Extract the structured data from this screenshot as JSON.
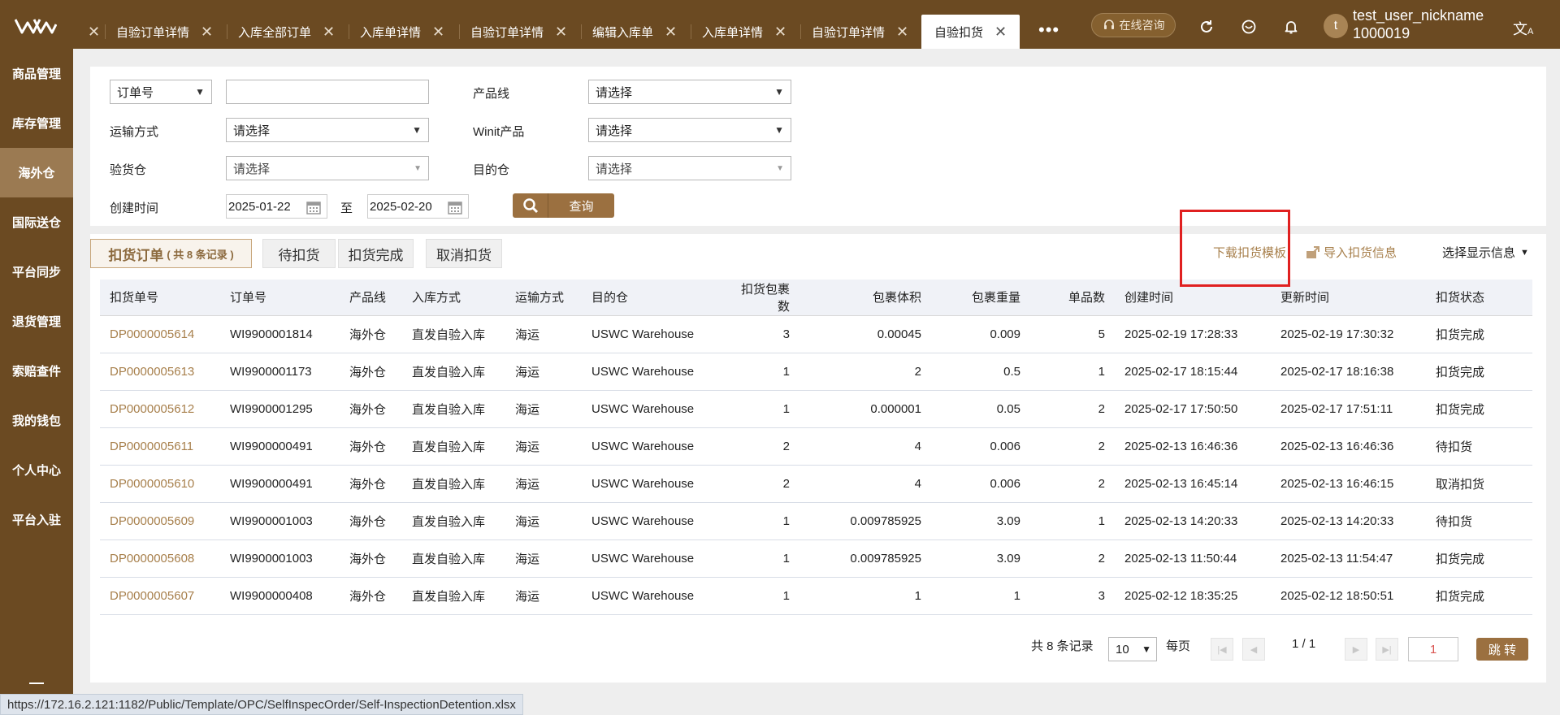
{
  "topbar": {
    "tabs": [
      {
        "label": "自验订单详情"
      },
      {
        "label": "入库全部订单"
      },
      {
        "label": "入库单详情"
      },
      {
        "label": "自验订单详情"
      },
      {
        "label": "编辑入库单"
      },
      {
        "label": "入库单详情"
      },
      {
        "label": "自验订单详情"
      },
      {
        "label": "自验扣货"
      }
    ],
    "active_tab": "自验扣货",
    "more": "•••",
    "consult_label": "在线咨询",
    "user": {
      "avatar_letter": "t",
      "nickname": "test_user_nickname",
      "id": "1000019"
    }
  },
  "sidebar": {
    "items": [
      {
        "label": "商品管理"
      },
      {
        "label": "库存管理"
      },
      {
        "label": "海外仓"
      },
      {
        "label": "国际送仓"
      },
      {
        "label": "平台同步"
      },
      {
        "label": "退货管理"
      },
      {
        "label": "索赔查件"
      },
      {
        "label": "我的钱包"
      },
      {
        "label": "个人中心"
      },
      {
        "label": "平台入驻"
      }
    ],
    "active": "海外仓"
  },
  "filters": {
    "order_type": {
      "value": "订单号"
    },
    "order_no": {
      "value": ""
    },
    "product_line": {
      "label": "产品线",
      "value": "请选择"
    },
    "shipping": {
      "label": "运输方式",
      "value": "请选择"
    },
    "winit_product": {
      "label": "Winit产品",
      "value": "请选择"
    },
    "inspect_wh": {
      "label": "验货仓",
      "value": "请选择"
    },
    "dest_wh": {
      "label": "目的仓",
      "value": "请选择"
    },
    "created": {
      "label": "创建时间",
      "from": "2025-01-22",
      "to_label": "至",
      "to": "2025-02-20"
    },
    "search_label": "查询"
  },
  "status_tabs": [
    {
      "label": "扣货订单",
      "count_text": "( 共 8 条记录 )"
    },
    {
      "label": "待扣货"
    },
    {
      "label": "扣货完成"
    },
    {
      "label": "取消扣货"
    }
  ],
  "actions": {
    "download_template": "下载扣货模板",
    "import_info": "导入扣货信息",
    "select_display": "选择显示信息"
  },
  "table": {
    "columns": [
      "扣货单号",
      "订单号",
      "产品线",
      "入库方式",
      "运输方式",
      "目的仓",
      "扣货包裹数",
      "包裹体积",
      "包裹重量",
      "单品数",
      "创建时间",
      "更新时间",
      "扣货状态"
    ],
    "rows": [
      [
        "DP0000005614",
        "WI9900001814",
        "海外仓",
        "直发自验入库",
        "海运",
        "USWC Warehouse",
        "3",
        "0.00045",
        "0.009",
        "5",
        "2025-02-19 17:28:33",
        "2025-02-19 17:30:32",
        "扣货完成"
      ],
      [
        "DP0000005613",
        "WI9900001173",
        "海外仓",
        "直发自验入库",
        "海运",
        "USWC Warehouse",
        "1",
        "2",
        "0.5",
        "1",
        "2025-02-17 18:15:44",
        "2025-02-17 18:16:38",
        "扣货完成"
      ],
      [
        "DP0000005612",
        "WI9900001295",
        "海外仓",
        "直发自验入库",
        "海运",
        "USWC Warehouse",
        "1",
        "0.000001",
        "0.05",
        "2",
        "2025-02-17 17:50:50",
        "2025-02-17 17:51:11",
        "扣货完成"
      ],
      [
        "DP0000005611",
        "WI9900000491",
        "海外仓",
        "直发自验入库",
        "海运",
        "USWC Warehouse",
        "2",
        "4",
        "0.006",
        "2",
        "2025-02-13 16:46:36",
        "2025-02-13 16:46:36",
        "待扣货"
      ],
      [
        "DP0000005610",
        "WI9900000491",
        "海外仓",
        "直发自验入库",
        "海运",
        "USWC Warehouse",
        "2",
        "4",
        "0.006",
        "2",
        "2025-02-13 16:45:14",
        "2025-02-13 16:46:15",
        "取消扣货"
      ],
      [
        "DP0000005609",
        "WI9900001003",
        "海外仓",
        "直发自验入库",
        "海运",
        "USWC Warehouse",
        "1",
        "0.009785925",
        "3.09",
        "1",
        "2025-02-13 14:20:33",
        "2025-02-13 14:20:33",
        "待扣货"
      ],
      [
        "DP0000005608",
        "WI9900001003",
        "海外仓",
        "直发自验入库",
        "海运",
        "USWC Warehouse",
        "1",
        "0.009785925",
        "3.09",
        "2",
        "2025-02-13 11:50:44",
        "2025-02-13 11:54:47",
        "扣货完成"
      ],
      [
        "DP0000005607",
        "WI9900000408",
        "海外仓",
        "直发自验入库",
        "海运",
        "USWC Warehouse",
        "1",
        "1",
        "1",
        "3",
        "2025-02-12 18:35:25",
        "2025-02-12 18:50:51",
        "扣货完成"
      ]
    ]
  },
  "pagination": {
    "total_text": "共 8 条记录",
    "page_size": "10",
    "per_page_label": "每页",
    "page_info": "1 / 1",
    "jump_value": "1",
    "jump_label": "跳 转"
  },
  "statusbar": {
    "url": "https://172.16.2.121:1182/Public/Template/OPC/SelfInspecOrder/Self-InspectionDetention.xlsx"
  },
  "colors": {
    "brand": "#6b4a22",
    "accent": "#9b7040",
    "link": "#a77f4b",
    "highlight": "#e02020"
  }
}
